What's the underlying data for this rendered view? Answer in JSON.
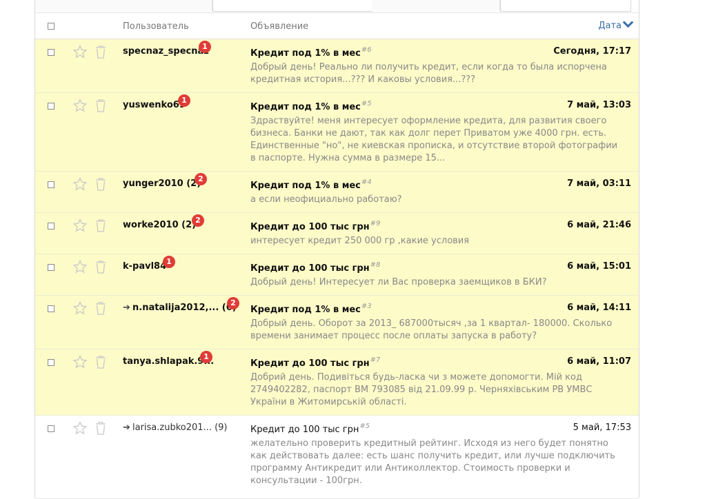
{
  "header": {
    "col_user": "Пользователь",
    "col_message": "Объявление",
    "col_date": "Дата"
  },
  "rows": [
    {
      "user": "specnaz_specnaz",
      "badge": "1",
      "subject": "Кредит под 1% в мес",
      "num": "#6",
      "date": "Сегодня, 17:17",
      "preview": "Добрый день! Реально ли получить кредит, если когда то была испорчена кредитная история...??? И каковы условия...???"
    },
    {
      "user": "yuswenko69",
      "badge": "1",
      "subject": "Кредит под 1% в мес",
      "num": "#5",
      "date": "7 май, 13:03",
      "preview": "Здраствуйте! меня интересует оформление кредита, для развития своего бизнеса. Банки не дают, так как долг перет Приватом уже 4000 грн. есть. Единственные \"но\", не киевская прописка, и отсутствие второй фотографии в паспорте. Нужна сумма в размере 15..."
    },
    {
      "user": "yunger2010 (2)",
      "badge": "2",
      "subject": "Кредит под 1% в мес",
      "num": "#4",
      "date": "7 май, 03:11",
      "preview": "а если неофициально работаю?"
    },
    {
      "user": "worke2010 (2)",
      "badge": "2",
      "subject": "Кредит до 100 тыс грн",
      "num": "#9",
      "date": "6 май, 21:46",
      "preview": "интересует кредит 250 000 гр ,какие условия"
    },
    {
      "user": "k-pavl84",
      "badge": "1",
      "subject": "Кредит до 100 тыс грн",
      "num": "#8",
      "date": "6 май, 15:01",
      "preview": "Добрый день! Интересует ли Вас проверка заемщиков в БКИ?"
    },
    {
      "user": "n.natalija2012,... (6)",
      "badge": "2",
      "subject": "Кредит под 1% в мес",
      "num": "#3",
      "date": "6 май, 14:11",
      "preview": "Добрый день. Оборот за 2013_ 687000тысяч ,за 1 квартал- 180000. Сколько времени занимает процесс после оплаты запуска в работу?"
    },
    {
      "user": "tanya.shlapak.9...",
      "badge": "1",
      "subject": "Кредит до 100 тыс грн",
      "num": "#7",
      "date": "6 май, 11:07",
      "preview": "Добрий день. Подивіться будь-ласка чи з можете допомогти. Мій код 2749402282, паспорт ВМ 793085 від 21.09.99 р. Черняхівським РВ УМВС України в Житомирській області."
    },
    {
      "user": "larisa.zubko201... (9)",
      "badge": "",
      "subject": "Кредит до 100 тыс грн",
      "num": "#5",
      "date": "5 май, 17:53",
      "preview": "желательно проверить кредитный рейтинг. Исходя из него будет понятно как действовать далее: есть шанс получить кредит, или лучше подключить программу Антикредит или Антиколлектор. Стоимость проверки и консультации - 100грн."
    }
  ],
  "icons": {
    "star": "star-icon",
    "trash": "trash-icon",
    "forward": "forward-arrow-icon",
    "sort": "chevron-down-icon"
  },
  "colors": {
    "unread_bg": "#fdfbc8",
    "badge": "#e03c37",
    "link": "#3a6ea8"
  }
}
